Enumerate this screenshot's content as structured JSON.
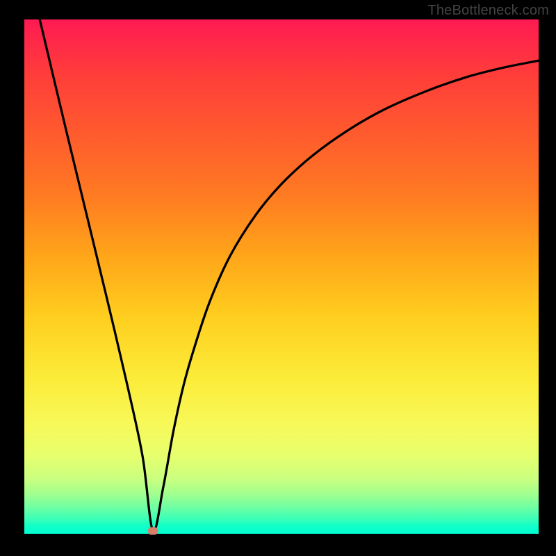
{
  "watermark": "TheBottleneck.com",
  "chart_data": {
    "type": "line",
    "title": "",
    "xlabel": "",
    "ylabel": "",
    "xlim": [
      0,
      100
    ],
    "ylim": [
      0,
      100
    ],
    "grid": false,
    "legend": false,
    "marker": {
      "x": 25,
      "y": 0.6,
      "color": "#d6806a"
    },
    "series": [
      {
        "name": "curve",
        "x": [
          3,
          8,
          12,
          16,
          20,
          23,
          25,
          27,
          29,
          31,
          33,
          36,
          40,
          45,
          50,
          56,
          63,
          70,
          78,
          86,
          93,
          100
        ],
        "y": [
          100,
          79,
          62.5,
          46,
          29,
          15,
          0.6,
          9,
          20,
          29,
          36,
          45,
          54,
          62,
          68,
          73.5,
          78.5,
          82.5,
          86,
          88.8,
          90.6,
          92
        ]
      }
    ],
    "colors": {
      "curve": "#000000",
      "background_top": "#ff1a52",
      "background_bottom": "#01ffd2"
    }
  }
}
